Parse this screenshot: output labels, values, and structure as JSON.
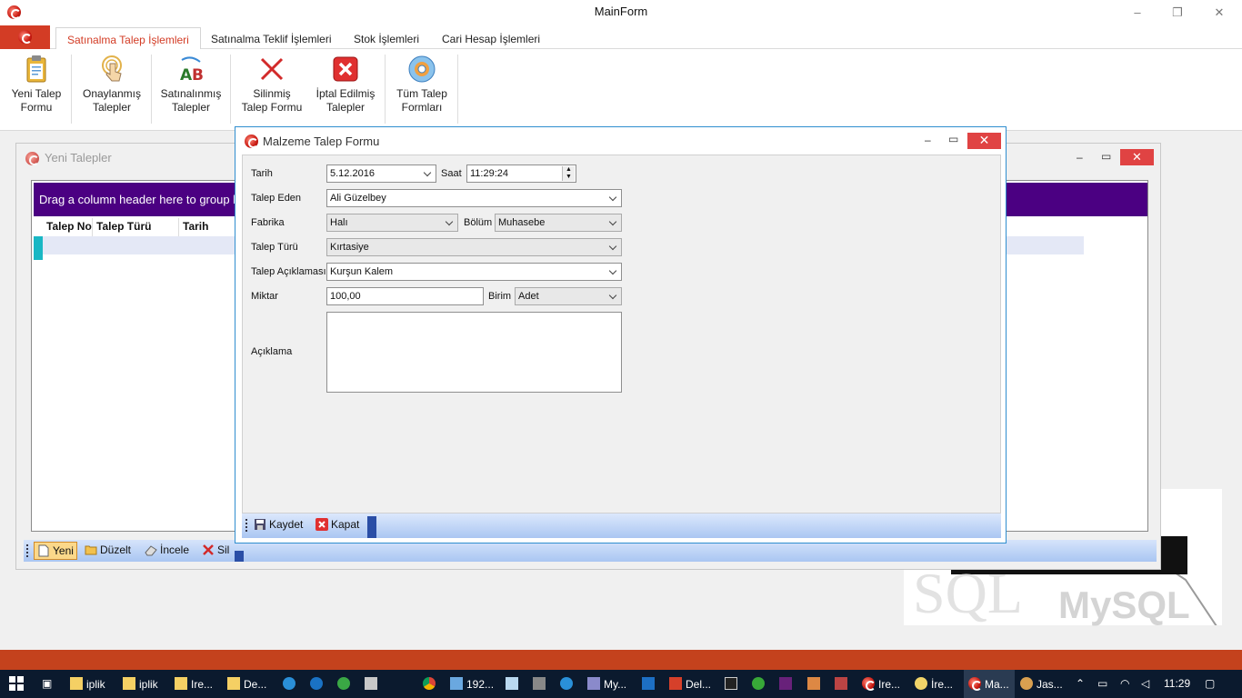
{
  "window": {
    "title": "MainForm",
    "minimize": "–",
    "restore": "❐",
    "close": "✕"
  },
  "ribbon": {
    "tabs": [
      {
        "label": "Satınalma Talep İşlemleri",
        "active": true
      },
      {
        "label": "Satınalma Teklif İşlemleri"
      },
      {
        "label": "Stok İşlemleri"
      },
      {
        "label": "Cari Hesap İşlemleri"
      }
    ],
    "buttons": [
      {
        "line1": "Yeni Talep",
        "line2": "Formu",
        "icon": "clipboard-icon"
      },
      {
        "line1": "Onaylanmış",
        "line2": "Talepler",
        "icon": "touch-icon"
      },
      {
        "line1": "Satınalınmış",
        "line2": "Talepler",
        "icon": "spellcheck-icon"
      },
      {
        "line1": "Silinmiş",
        "line2": "Talep Formu",
        "icon": "x-icon"
      },
      {
        "line1": "İptal Edilmiş",
        "line2": "Talepler",
        "icon": "red-x-icon"
      },
      {
        "line1": "Tüm Talep",
        "line2": "Formları",
        "icon": "disc-icon"
      }
    ]
  },
  "child_window": {
    "title": "Yeni Talepler",
    "group_panel": "Drag a column header here to group by that column",
    "columns": [
      "Talep No",
      "Talep Türü",
      "Tarih"
    ],
    "toolbar": [
      "Yeni",
      "Düzelt",
      "İncele",
      "Sil"
    ]
  },
  "modal": {
    "title": "Malzeme Talep Formu",
    "fields": {
      "tarih_label": "Tarih",
      "tarih_value": "5.12.2016",
      "saat_label": "Saat",
      "saat_value": "11:29:24",
      "talep_eden_label": "Talep Eden",
      "talep_eden_value": "Ali Güzelbey",
      "fabrika_label": "Fabrika",
      "fabrika_value": "Halı",
      "bolum_label": "Bölüm",
      "bolum_value": "Muhasebe",
      "talep_turu_label": "Talep Türü",
      "talep_turu_value": "Kırtasiye",
      "talep_aciklamasi_label": "Talep Açıklaması",
      "talep_aciklamasi_value": "Kurşun Kalem",
      "miktar_label": "Miktar",
      "miktar_value": "100,00",
      "birim_label": "Birim",
      "birim_value": "Adet",
      "aciklama_label": "Açıklama",
      "aciklama_value": ""
    },
    "toolbar": {
      "save": "Kaydet",
      "close": "Kapat"
    }
  },
  "watermark": {
    "text1": "SQL",
    "text2": "MySQL"
  },
  "taskbar": {
    "items": [
      {
        "label": "iplik",
        "icon": "folder-icon"
      },
      {
        "label": "iplik",
        "icon": "folder-icon"
      },
      {
        "label": "Ire...",
        "icon": "folder-icon"
      },
      {
        "label": "De...",
        "icon": "folder-icon"
      },
      {
        "label": "192...",
        "icon": "remote-icon"
      },
      {
        "label": "My...",
        "icon": "vs-icon"
      },
      {
        "label": "Del...",
        "icon": "delphi-icon"
      },
      {
        "label": "Ire...",
        "icon": "app-icon"
      },
      {
        "label": "İre...",
        "icon": "app-icon"
      },
      {
        "label": "Ma...",
        "icon": "app-icon"
      },
      {
        "label": "Jas...",
        "icon": "jasper-icon"
      }
    ],
    "clock": "11:29"
  },
  "colors": {
    "accent": "#d33c25",
    "group_panel": "#4b0082",
    "taskbar": "#0b1a2e",
    "strip": "#c4421d"
  }
}
